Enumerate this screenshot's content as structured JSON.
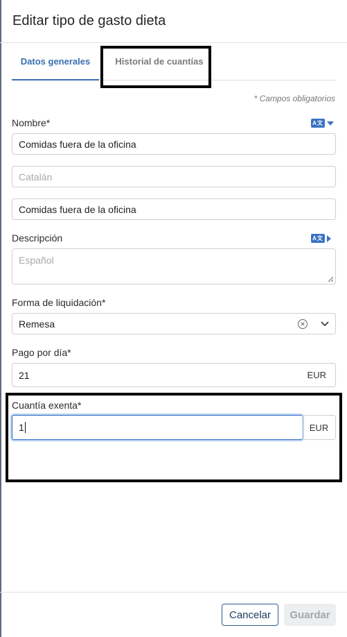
{
  "dialog": {
    "title": "Editar tipo de gasto dieta"
  },
  "tabs": [
    {
      "label": "Datos generales",
      "active": true
    },
    {
      "label": "Historial de cuantías",
      "active": false
    }
  ],
  "required_note": "* Campos obligatorios",
  "fields": {
    "nombre": {
      "label": "Nombre*",
      "lang_icon": "translate-icon",
      "values": [
        "Comidas fuera de la oficina",
        "",
        "Comidas fuera de la oficina"
      ],
      "placeholder_catalan": "Catalán"
    },
    "descripcion": {
      "label": "Descripción",
      "placeholder": "Español"
    },
    "forma_liquidacion": {
      "label": "Forma de liquidación*",
      "value": "Remesa"
    },
    "pago_dia": {
      "label": "Pago por día*",
      "value": "21",
      "unit": "EUR"
    },
    "cuantia_exenta": {
      "label": "Cuantía exenta*",
      "value": "1",
      "unit": "EUR"
    }
  },
  "footer": {
    "cancel_label": "Cancelar",
    "save_label": "Guardar"
  },
  "colors": {
    "accent": "#3a6fb0",
    "highlight_border": "#000000"
  }
}
